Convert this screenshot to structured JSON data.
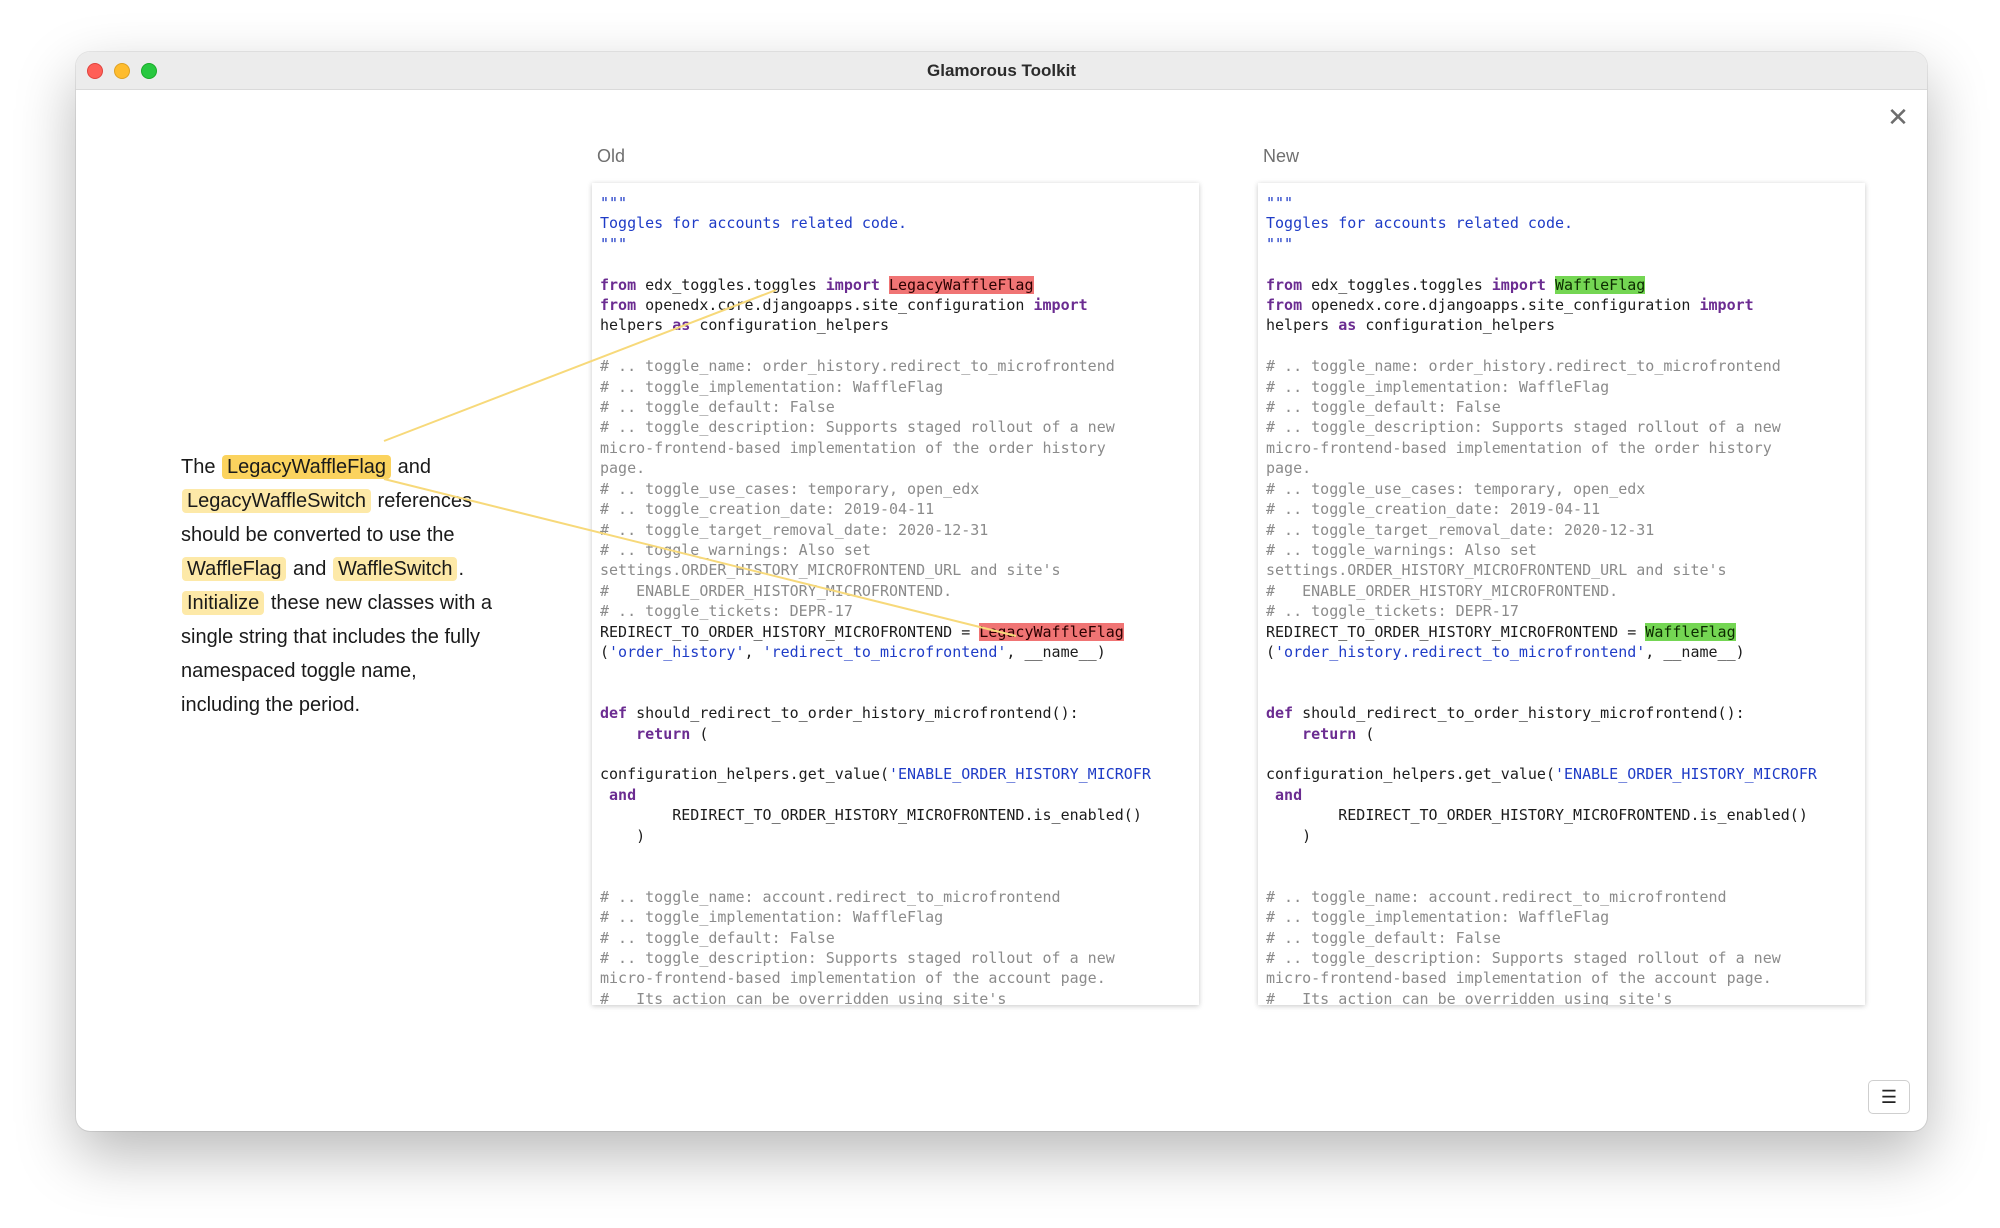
{
  "window": {
    "title": "Glamorous Toolkit"
  },
  "explanation": {
    "t1": "The ",
    "h1": "LegacyWaffleFlag",
    "t2": " and ",
    "h2": "LegacyWaffleSwitch",
    "t3": " references should be converted to use the ",
    "h3": "WaffleFlag",
    "t4": " and ",
    "h4": "WaffleSwitch",
    "t5": ". ",
    "h5": "Initialize",
    "t6": " these new classes with a single string that includes the fully namespaced toggle name, including the period."
  },
  "old": {
    "label": "Old",
    "l01": "\"\"\"",
    "l02": "Toggles for accounts related code.",
    "l03": "\"\"\"",
    "l05a": "from",
    "l05b": " edx_toggles.toggles ",
    "l05c": "import",
    "l05d": " ",
    "l05e": "LegacyWaffleFlag",
    "l06a": "from",
    "l06b": " openedx.core.djangoapps.site_configuration ",
    "l06c": "import",
    "l07a": "helpers ",
    "l07b": "as",
    "l07c": " configuration_helpers",
    "l09": "# .. toggle_name: order_history.redirect_to_microfrontend",
    "l10": "# .. toggle_implementation: WaffleFlag",
    "l11": "# .. toggle_default: False",
    "l12": "# .. toggle_description: Supports staged rollout of a new",
    "l13": "micro-frontend-based implementation of the order history",
    "l14": "page.",
    "l15": "# .. toggle_use_cases: temporary, open_edx",
    "l16": "# .. toggle_creation_date: 2019-04-11",
    "l17": "# .. toggle_target_removal_date: 2020-12-31",
    "l18": "# .. toggle_warnings: Also set",
    "l19": "settings.ORDER_HISTORY_MICROFRONTEND_URL and site's",
    "l20": "#   ENABLE_ORDER_HISTORY_MICROFRONTEND.",
    "l21": "# .. toggle_tickets: DEPR-17",
    "l22a": "REDIRECT_TO_ORDER_HISTORY_MICROFRONTEND = ",
    "l22b": "LegacyWaffleFlag",
    "l23a": "(",
    "l23b": "'order_history'",
    "l23c": ", ",
    "l23d": "'redirect_to_microfrontend'",
    "l23e": ", __name__)",
    "l26a": "def",
    "l26b": " should_redirect_to_order_history_microfrontend():",
    "l27a": "    ",
    "l27b": "return",
    "l27c": " (",
    "l29a": "configuration_helpers.get_value(",
    "l29b": "'ENABLE_ORDER_HISTORY_MICROFR",
    "l30a": " ",
    "l30b": "and",
    "l31": "        REDIRECT_TO_ORDER_HISTORY_MICROFRONTEND.is_enabled()",
    "l32": "    )",
    "l35": "# .. toggle_name: account.redirect_to_microfrontend",
    "l36": "# .. toggle_implementation: WaffleFlag",
    "l37": "# .. toggle_default: False",
    "l38": "# .. toggle_description: Supports staged rollout of a new",
    "l39": "micro-frontend-based implementation of the account page.",
    "l40": "#   Its action can be overridden using site's"
  },
  "new": {
    "label": "New",
    "l01": "\"\"\"",
    "l02": "Toggles for accounts related code.",
    "l03": "\"\"\"",
    "l05a": "from",
    "l05b": " edx_toggles.toggles ",
    "l05c": "import",
    "l05d": " ",
    "l05e": "WaffleFlag",
    "l06a": "from",
    "l06b": " openedx.core.djangoapps.site_configuration ",
    "l06c": "import",
    "l07a": "helpers ",
    "l07b": "as",
    "l07c": " configuration_helpers",
    "l09": "# .. toggle_name: order_history.redirect_to_microfrontend",
    "l10": "# .. toggle_implementation: WaffleFlag",
    "l11": "# .. toggle_default: False",
    "l12": "# .. toggle_description: Supports staged rollout of a new",
    "l13": "micro-frontend-based implementation of the order history",
    "l14": "page.",
    "l15": "# .. toggle_use_cases: temporary, open_edx",
    "l16": "# .. toggle_creation_date: 2019-04-11",
    "l17": "# .. toggle_target_removal_date: 2020-12-31",
    "l18": "# .. toggle_warnings: Also set",
    "l19": "settings.ORDER_HISTORY_MICROFRONTEND_URL and site's",
    "l20": "#   ENABLE_ORDER_HISTORY_MICROFRONTEND.",
    "l21": "# .. toggle_tickets: DEPR-17",
    "l22a": "REDIRECT_TO_ORDER_HISTORY_MICROFRONTEND = ",
    "l22b": "WaffleFlag",
    "l23a": "(",
    "l23b": "'order_history.redirect_to_microfrontend'",
    "l23c": ", __name__)",
    "l26a": "def",
    "l26b": " should_redirect_to_order_history_microfrontend():",
    "l27a": "    ",
    "l27b": "return",
    "l27c": " (",
    "l29a": "configuration_helpers.get_value(",
    "l29b": "'ENABLE_ORDER_HISTORY_MICROFR",
    "l30a": " ",
    "l30b": "and",
    "l31": "        REDIRECT_TO_ORDER_HISTORY_MICROFRONTEND.is_enabled()",
    "l32": "    )",
    "l35": "# .. toggle_name: account.redirect_to_microfrontend",
    "l36": "# .. toggle_implementation: WaffleFlag",
    "l37": "# .. toggle_default: False",
    "l38": "# .. toggle_description: Supports staged rollout of a new",
    "l39": "micro-frontend-based implementation of the account page.",
    "l40": "#   Its action can be overridden using site's"
  },
  "colors": {
    "removed_highlight": "#f07474",
    "added_highlight": "#74d653",
    "annotation_highlight": "#fbd35e",
    "connector_line": "#f7d97a"
  },
  "icons": {
    "close": "close-icon",
    "menu": "menu-icon"
  }
}
